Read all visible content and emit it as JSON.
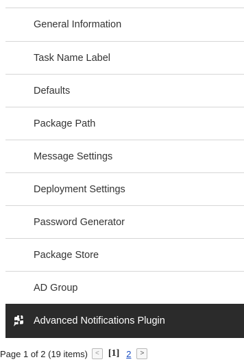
{
  "menu": {
    "items": [
      {
        "label": "General Information"
      },
      {
        "label": "Task Name Label"
      },
      {
        "label": "Defaults"
      },
      {
        "label": "Package Path"
      },
      {
        "label": "Message Settings"
      },
      {
        "label": "Deployment Settings"
      },
      {
        "label": "Password Generator"
      },
      {
        "label": "Package Store"
      },
      {
        "label": "AD Group"
      },
      {
        "label": "Advanced Notifications Plugin",
        "icon": "puzzle-icon",
        "active": true
      }
    ]
  },
  "pager": {
    "summary": "Page 1 of 2 (19 items)",
    "prev_glyph": "<",
    "current_page": "[1]",
    "next_page": "2",
    "next_glyph": ">"
  },
  "colors": {
    "active_bg": "#2b2b2b",
    "active_text": "#ffffff",
    "divider": "#d6d6d6",
    "link": "#1a4fc4"
  }
}
